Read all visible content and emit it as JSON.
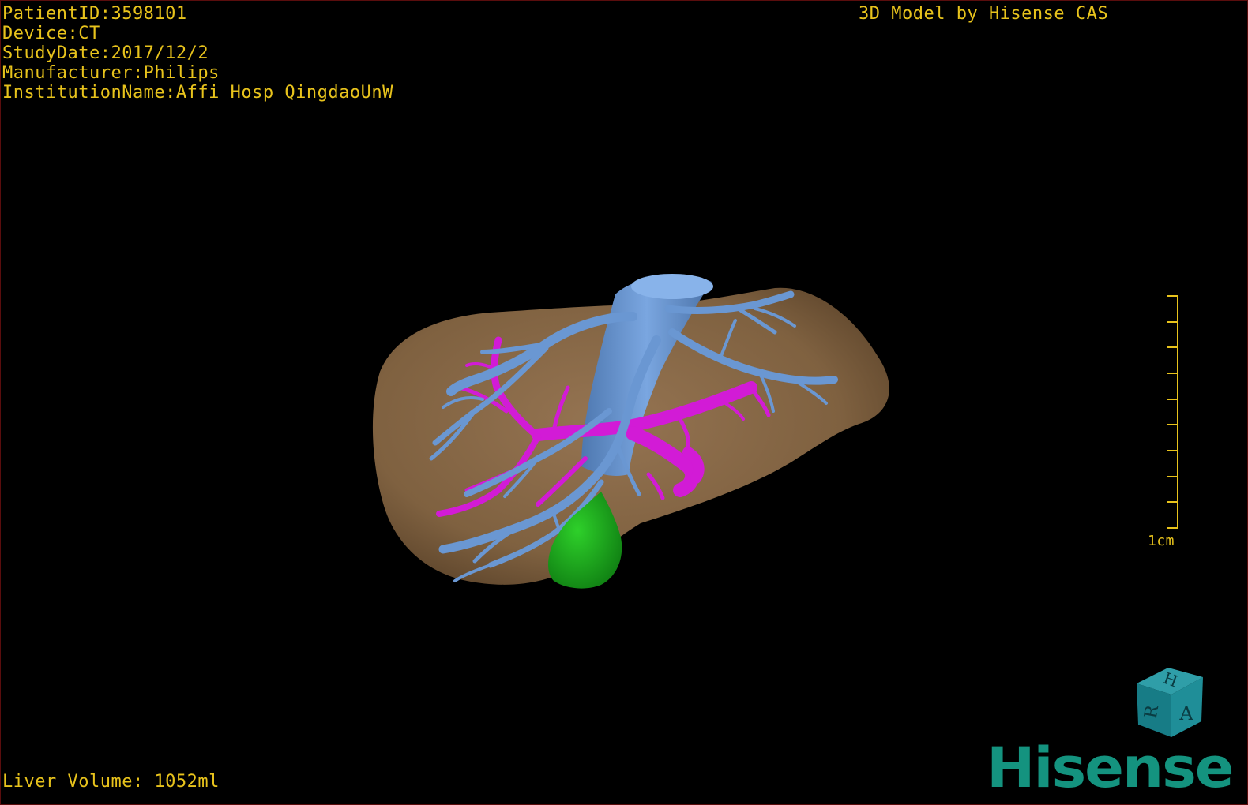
{
  "patient": {
    "id_line": "PatientID:3598101",
    "device_line": "Device:CT",
    "date_line": "StudyDate:2017/12/2",
    "manufacturer_line": "Manufacturer:Philips",
    "institution_line": "InstitutionName:Affi Hosp QingdaoUnW"
  },
  "credit": "3D Model by Hisense CAS",
  "volume": "Liver Volume: 1052ml",
  "scale": {
    "label": "1cm"
  },
  "orientation_cube": {
    "top_letter": "H",
    "left_letter": "R",
    "front_letter": "A"
  },
  "brand": "Hisense",
  "colors": {
    "overlay_text": "#e8c31c",
    "liver": "#8a6a45",
    "hepatic_vein": "#6a97d2",
    "portal_vein": "#d21bd6",
    "gallbladder": "#18a41a",
    "brand": "#14937f"
  }
}
